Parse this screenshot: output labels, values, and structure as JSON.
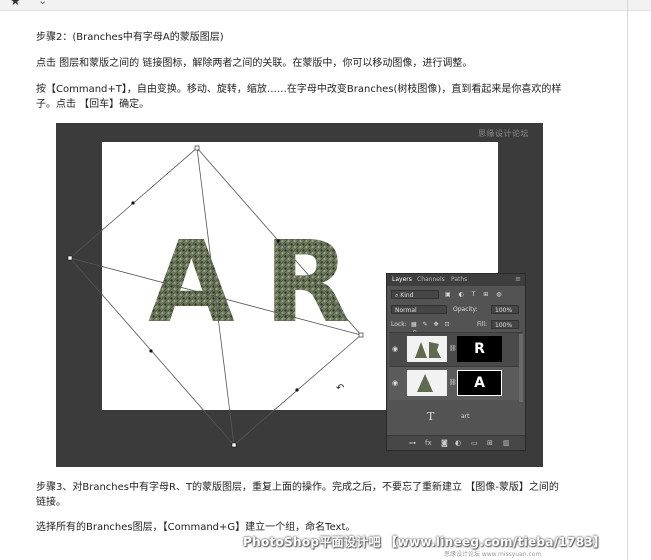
{
  "step2": {
    "title": "步骤2：(Branches中有字母A的蒙版图层)",
    "p1": "点击 图层和蒙版之间的 链接图标，解除两者之间的关联。在蒙版中，你可以移动图像，进行调整。",
    "p2": "按【Command+T】，自由变换。移动、旋转，缩放……在字母中改变Branches(树枝图像)，直到看起来是你喜欢的样子。点击 【回车】确定。"
  },
  "screenshot": {
    "watermark": "思缘设计论坛",
    "letters": [
      "A",
      "R"
    ],
    "layers_panel": {
      "tabs": [
        "Layers",
        "Channels",
        "Paths"
      ],
      "filter": "Kind",
      "blend_mode": "Normal",
      "opacity_label": "Opacity:",
      "opacity": "100%",
      "lock_label": "Lock:",
      "fill_label": "Fill:",
      "fill": "100%",
      "layers": [
        {
          "mask_letter": "R"
        },
        {
          "mask_letter": "A"
        }
      ],
      "text_layer_name": "art",
      "footer_icons": [
        "link-icon",
        "fx-icon",
        "mask-icon",
        "adjustment-icon",
        "folder-icon",
        "new-layer-icon",
        "trash-icon"
      ]
    }
  },
  "step3": {
    "p1": "步骤3、对Branches中有字母R、T的蒙版图层，重复上面的操作。完成之后，不要忘了重新建立 【图像-蒙版】之间的 链接。",
    "p2": "选择所有的Branches图层，【Command+G】建立一个组，命名Text。"
  },
  "footer": {
    "banner": "PhotoShop平面设计吧 【www.lineeg.com/tieba/1783】",
    "signature": "思缘设计论坛  www.missyuan.com"
  },
  "colors": {
    "canvas_bg": "#3b3b3b",
    "panel_bg": "#535353",
    "text": "#222222"
  }
}
